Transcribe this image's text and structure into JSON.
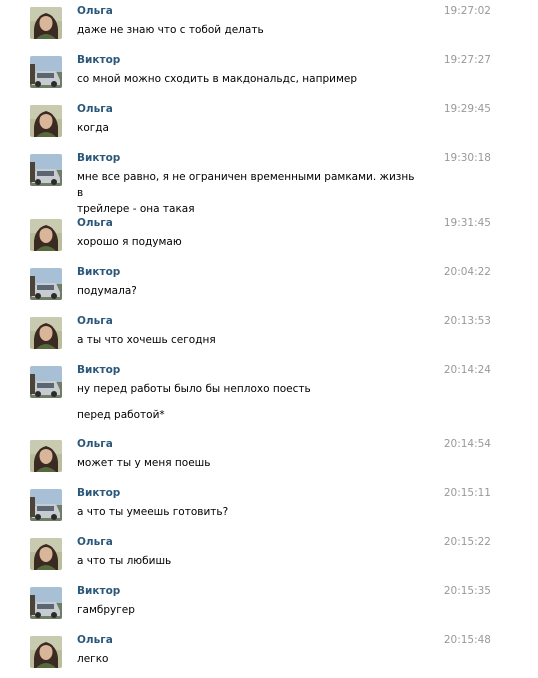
{
  "messages": [
    {
      "author": "Ольга",
      "avatar": "olga-avatar",
      "time": "19:27:02",
      "lines": [
        "даже не знаю что с тобой делать"
      ]
    },
    {
      "author": "Виктор",
      "avatar": "viktor-avatar",
      "time": "19:27:27",
      "lines": [
        "со мной можно сходить в макдональдс, например"
      ]
    },
    {
      "author": "Ольга",
      "avatar": "olga-avatar",
      "time": "19:29:45",
      "lines": [
        "когда"
      ]
    },
    {
      "author": "Виктор",
      "avatar": "viktor-avatar",
      "time": "19:30:18",
      "lines": [
        "мне все равно, я не ограничен временными рамками. жизнь в",
        "трейлере - она такая"
      ]
    },
    {
      "author": "Ольга",
      "avatar": "olga-avatar",
      "time": "19:31:45",
      "lines": [
        "хорошо я подумаю"
      ]
    },
    {
      "author": "Виктор",
      "avatar": "viktor-avatar",
      "time": "20:04:22",
      "lines": [
        "подумала?"
      ]
    },
    {
      "author": "Ольга",
      "avatar": "olga-avatar",
      "time": "20:13:53",
      "lines": [
        "а ты что хочешь сегодня"
      ]
    },
    {
      "author": "Виктор",
      "avatar": "viktor-avatar",
      "time": "20:14:24",
      "lines": [
        "ну перед работы было бы неплохо поесть",
        "",
        "перед работой*"
      ]
    },
    {
      "author": "Ольга",
      "avatar": "olga-avatar",
      "time": "20:14:54",
      "lines": [
        "может ты у меня поешь"
      ]
    },
    {
      "author": "Виктор",
      "avatar": "viktor-avatar",
      "time": "20:15:11",
      "lines": [
        "а что ты умеешь готовить?"
      ]
    },
    {
      "author": "Ольга",
      "avatar": "olga-avatar",
      "time": "20:15:22",
      "lines": [
        "а что ты любишь"
      ]
    },
    {
      "author": "Виктор",
      "avatar": "viktor-avatar",
      "time": "20:15:35",
      "lines": [
        "гамбругер"
      ]
    },
    {
      "author": "Ольга",
      "avatar": "olga-avatar",
      "time": "20:15:48",
      "lines": [
        "легко"
      ]
    }
  ]
}
